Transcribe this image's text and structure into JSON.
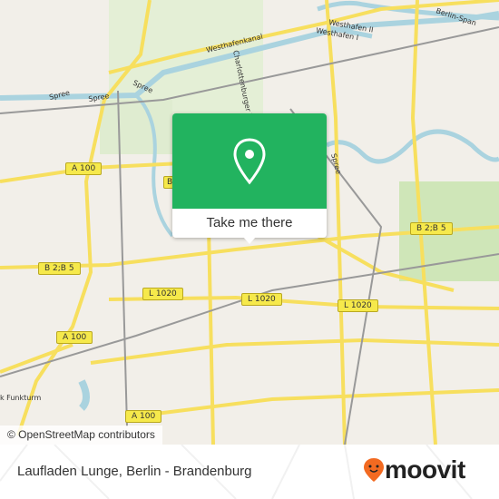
{
  "map": {
    "labels": {
      "westhafenkanal": "Westhafenkanal",
      "westhafen2": "Westhafen II",
      "westhafen1": "Westhafen I",
      "berlin_spandau": "Berlin-Span",
      "charlottenburger": "Charlottenburger V",
      "spree1": "Spree",
      "spree2": "Spree",
      "spree3": "Spree",
      "spree4": "Spree",
      "funkturm": "k Funkturm"
    },
    "shields": {
      "a100_1": "A 100",
      "a100_2": "A 100",
      "a100_3": "A 100",
      "b2b5_1": "B 2;B 5",
      "b2b5_2": "B 2;B 5",
      "l1020_1": "L 1020",
      "l1020_2": "L 1020",
      "l1020_3": "L 1020",
      "b_partial": "B"
    },
    "attribution": "© OpenStreetMap contributors"
  },
  "popup": {
    "button_label": "Take me there",
    "icon": "map-pin-icon",
    "color": "#22b35f"
  },
  "footer": {
    "place": "Laufladen Lunge, Berlin - Brandenburg",
    "logo_text": "moovit",
    "logo_color": "#f26a21"
  }
}
